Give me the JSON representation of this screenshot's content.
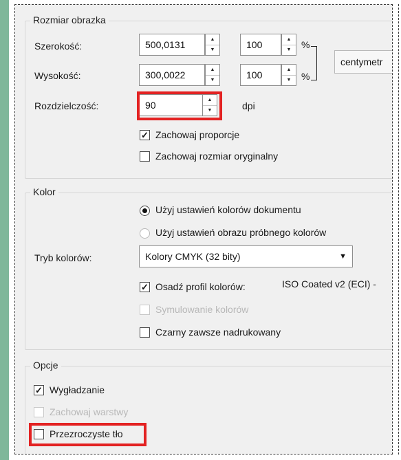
{
  "image_size": {
    "title": "Rozmiar obrazka",
    "width_label": "Szerokość:",
    "width_value": "500,0131",
    "width_percent": "100",
    "height_label": "Wysokość:",
    "height_value": "300,0022",
    "height_percent": "100",
    "percent_symbol": "%",
    "unit_button": "centymetr",
    "resolution_label": "Rozdzielczość:",
    "resolution_value": "90",
    "resolution_unit": "dpi",
    "keep_proportions_label": "Zachowaj proporcje",
    "keep_proportions_checked": true,
    "keep_original_label": "Zachowaj rozmiar oryginalny",
    "keep_original_checked": false
  },
  "color": {
    "title": "Kolor",
    "radio_document": "Użyj ustawień kolorów dokumentu",
    "radio_proof": "Użyj ustawień obrazu próbnego kolorów",
    "mode_label": "Tryb kolorów:",
    "mode_value": "Kolory CMYK (32 bity)",
    "embed_profile_label": "Osadź profil kolorów:",
    "embed_profile_checked": true,
    "profile_name": "ISO Coated v2 (ECI) -",
    "simulate_label": "Symulowanie kolorów",
    "black_overprint_label": "Czarny zawsze nadrukowany",
    "black_overprint_checked": false
  },
  "options": {
    "title": "Opcje",
    "smoothing_label": "Wygładzanie",
    "smoothing_checked": true,
    "keep_layers_label": "Zachowaj warstwy",
    "transparent_bg_label": "Przezroczyste tło",
    "transparent_bg_checked": false
  },
  "icons": {
    "spin_up": "▲",
    "spin_down": "▼",
    "dropdown": "▼",
    "checkmark": "✓"
  },
  "highlight_color": "#e32222"
}
